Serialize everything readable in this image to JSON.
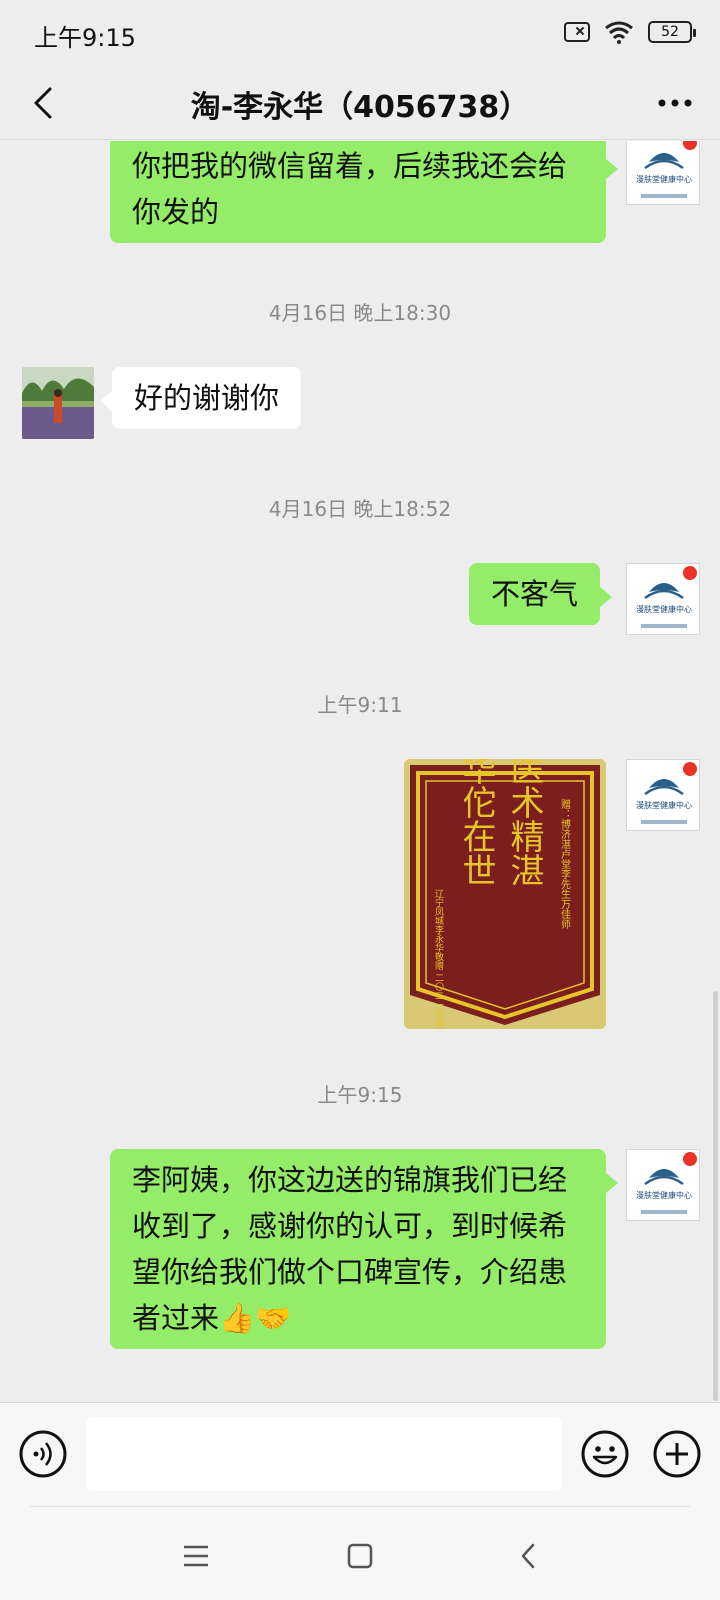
{
  "status_bar": {
    "time": "上午9:15",
    "battery": "52",
    "icons": [
      "sim-off-icon",
      "wifi-icon",
      "battery-icon"
    ]
  },
  "header": {
    "title": "淘-李永华（4056738）",
    "back_icon": "back-chevron-icon",
    "more_icon": "more-dots-icon"
  },
  "messages": {
    "msg1": "你把我的微信留着，后续我还会给你发的",
    "time1": "4月16日 晚上18:30",
    "msg2": "好的谢谢你",
    "time2": "4月16日 晚上18:52",
    "msg3": "不客气",
    "time3": "上午9:11",
    "banner": {
      "line1": "华佗在世",
      "line2": "医术精湛",
      "side_right": "赠：博济湛卢堂李先生万佳师",
      "side_left": "辽宁凤城李永华敬赠 二〇二一年四月"
    },
    "time4": "上午9:15",
    "msg4": "李阿姨，你这边送的锦旗我们已经收到了，感谢你的认可，到时候希望你给我们做个口碑宣传，介绍患者过来",
    "msg4_emoji": "👍🤝"
  },
  "self_avatar": {
    "caption": "漫肤堂健康中心"
  },
  "input_bar": {
    "voice_icon": "voice-icon",
    "emoji_icon": "emoji-icon",
    "plus_icon": "plus-icon",
    "placeholder": ""
  },
  "nav_bar": {
    "icons": [
      "menu-icon",
      "home-icon",
      "back-icon"
    ]
  },
  "colors": {
    "sent_bubble": "#95ec69",
    "received_bubble": "#ffffff",
    "background": "#ededed",
    "banner_red": "#7a1e1e",
    "banner_gold": "#e6c42a"
  }
}
